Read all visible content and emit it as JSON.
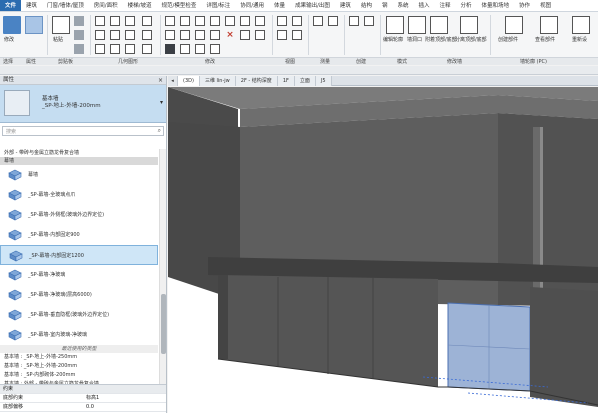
{
  "menu": {
    "tabs": [
      "文件",
      "建筑",
      "门窗/墙体/屋顶",
      "房间/面积",
      "楼梯/坡道",
      "规范/模型检查",
      "详图/标注",
      "协同/通用",
      "体量",
      "成果输出/出图",
      "建筑",
      "结构",
      "钢",
      "系统",
      "插入",
      "注释",
      "分析",
      "体量和场地",
      "协作",
      "视图"
    ]
  },
  "ribbon": {
    "panels": [
      "选择",
      "属性",
      "剪贴板",
      "几何图形",
      "修改",
      "视图",
      "测量",
      "创建",
      "模式",
      "修改墙",
      "墙轮廓 (PC)"
    ],
    "labels": {
      "modify": "修改",
      "edit_wall": "编辑轮廓",
      "wall_opening": "墙洞口",
      "attach": "附着顶部/底部",
      "detach": "分离顶部/底部",
      "create_assembly": "创建部件",
      "view_assembly": "查看部件",
      "reset": "重新设",
      "paste": "粘贴",
      "cut": "剪切",
      "join": "连接"
    }
  },
  "properties": {
    "title": "属性",
    "type_family": "基本墙",
    "type_name": "_SP-地上-外墙-200mm",
    "search_placeholder": "搜索",
    "list": [
      {
        "kind": "plain",
        "text": "外部 - 带砖与金属立筋龙骨复合墙"
      },
      {
        "kind": "cat",
        "text": "幕墙"
      },
      {
        "kind": "item",
        "text": "幕墙"
      },
      {
        "kind": "item",
        "text": "_SP-幕墙-全玻璃点爪"
      },
      {
        "kind": "item",
        "text": "_SP-幕墙-外侧框(玻璃外边界定位)"
      },
      {
        "kind": "item",
        "text": "_SP-幕墙-内部固定900"
      },
      {
        "kind": "item",
        "text": "_SP-幕墙-内部固定1200",
        "selected": true
      },
      {
        "kind": "item",
        "text": "_SP-幕墙-净玻璃"
      },
      {
        "kind": "item",
        "text": "_SP-幕墙-净玻璃(层高6000)"
      },
      {
        "kind": "item",
        "text": "_SP-幕墙-垂直隐框(玻璃外边界定位)"
      },
      {
        "kind": "item",
        "text": "_SP-幕墙-室内玻璃-净玻璃"
      },
      {
        "kind": "dim",
        "text": "最近使用的类型"
      },
      {
        "kind": "recent",
        "text": "基本墙 : _SP-地上-外墙-250mm"
      },
      {
        "kind": "recent",
        "text": "基本墙 : _SP-地上-外墙-200mm"
      },
      {
        "kind": "recent",
        "text": "基本墙 : _SP-内部砌体-200mm"
      },
      {
        "kind": "recent",
        "text": "基本墙 : 外部 - 带砖与金属立筋龙骨复合墙"
      }
    ],
    "bottom": [
      {
        "label": "约束",
        "value": ""
      },
      {
        "label": "底部约束",
        "value": "标高1"
      },
      {
        "label": "底部偏移",
        "value": "0.0"
      }
    ]
  },
  "view_tabs": {
    "tabs": [
      "(3D)",
      "三维 lin-jw",
      "2F - 结构深度",
      "1F",
      "立面",
      "J5"
    ],
    "active": "(3D)"
  },
  "colors": {
    "accent": "#2b6cb0",
    "wall_top": "#7a7a7a",
    "wall_front": "#5b5b5b",
    "wall_side": "#474747",
    "glass": "#9db3d6",
    "selection": "#cfe6f7"
  }
}
